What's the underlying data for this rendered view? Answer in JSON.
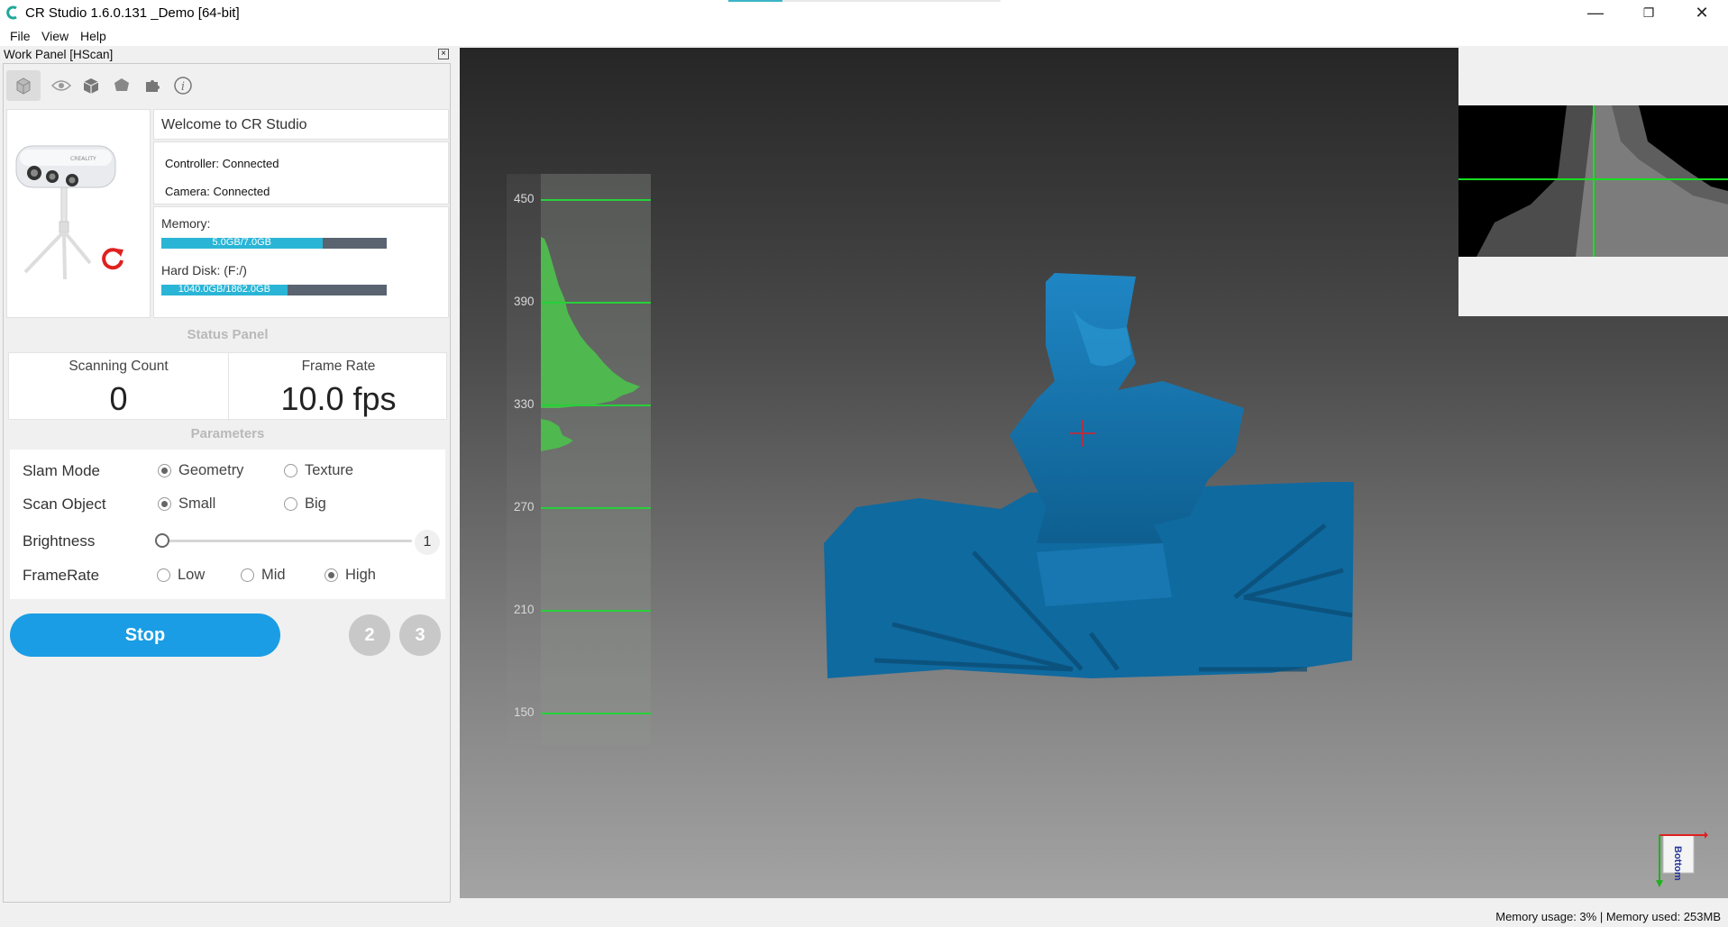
{
  "window": {
    "title": "CR Studio 1.6.0.131 _Demo [64-bit]",
    "minimize": "—",
    "maximize": "❐",
    "close": "✕"
  },
  "menu": [
    "File",
    "View",
    "Help"
  ],
  "work_panel": {
    "title": "Work Panel [HScan]",
    "close": "×",
    "toolbar_icons": [
      "cube-icon",
      "eye-icon",
      "box-icon",
      "mesh-icon",
      "puzzle-icon",
      "info-icon"
    ]
  },
  "device": {
    "welcome": "Welcome to CR Studio",
    "controller": "Controller: Connected",
    "camera": "Camera: Connected",
    "memory_label": "Memory:",
    "memory_text": "5.0GB/7.0GB",
    "memory_fraction": 0.714,
    "disk_label": "Hard Disk: (F:/)",
    "disk_text": "1040.0GB/1862.0GB",
    "disk_fraction": 0.559,
    "accent": "#2ab5d6",
    "refresh_color": "#e02020"
  },
  "status_panel": {
    "title": "Status Panel",
    "scan_count_label": "Scanning Count",
    "scan_count_value": "0",
    "frame_rate_label": "Frame Rate",
    "frame_rate_value": "10.0 fps"
  },
  "parameters": {
    "title": "Parameters",
    "slam_mode": {
      "label": "Slam Mode",
      "options": [
        "Geometry",
        "Texture"
      ],
      "selected": "Geometry"
    },
    "scan_object": {
      "label": "Scan Object",
      "options": [
        "Small",
        "Big"
      ],
      "selected": "Small"
    },
    "brightness": {
      "label": "Brightness",
      "value": "1"
    },
    "frame_rate": {
      "label": "FrameRate",
      "options": [
        "Low",
        "Mid",
        "High"
      ],
      "selected": "High"
    }
  },
  "actions": {
    "stop": "Stop",
    "step2": "2",
    "step3": "3",
    "primary_color": "#1a9de4"
  },
  "histogram": {
    "ticks": [
      "450",
      "390",
      "330",
      "270",
      "210",
      "150"
    ],
    "color": "#27d03a"
  },
  "axis_widget": {
    "label": "Bottom"
  },
  "statusbar": {
    "text": "Memory usage: 3% | Memory used: 253MB"
  }
}
